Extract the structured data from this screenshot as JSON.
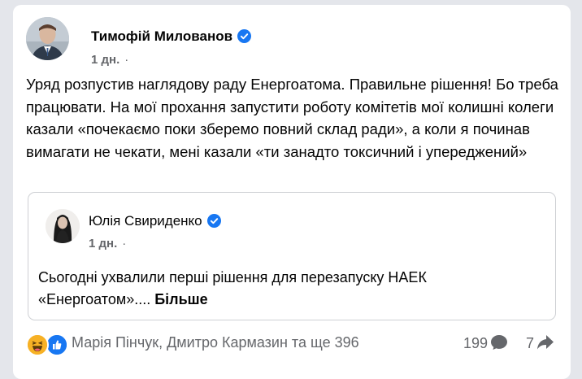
{
  "post": {
    "author": "Тимофій Милованов",
    "time": "1 дн.",
    "separator": "·",
    "text": "Уряд розпустив наглядову раду Енергоатома. Правильне рішення! Бо треба працювати. На мої прохання запустити роботу комітетів мої колишні колеги казали «почекаємо поки зберемо повний склад ради», а коли я починав вимагати не чекати, мені казали «ти занадто токсичний і упереджений»"
  },
  "shared_post": {
    "author": "Юлія Свириденко",
    "time": "1 дн.",
    "separator": "·",
    "text": "Сьогодні ухвалили перші рішення для перезапуску НАЕК «Енергоатом»....",
    "more_label": "Більше"
  },
  "footer": {
    "reactors": "Марія Пінчук, Дмитро Кармазин та ще 396",
    "comments_count": "199",
    "shares_count": "7"
  },
  "colors": {
    "accent": "#1877f2",
    "secondary_text": "#65676b",
    "haha": "#f7b125"
  },
  "icons": {
    "verified": "verified-badge-icon",
    "like": "like-reaction-icon",
    "haha": "haha-reaction-icon",
    "comment": "comment-bubble-icon",
    "share": "share-arrow-icon",
    "globe": "audience-globe-icon"
  }
}
